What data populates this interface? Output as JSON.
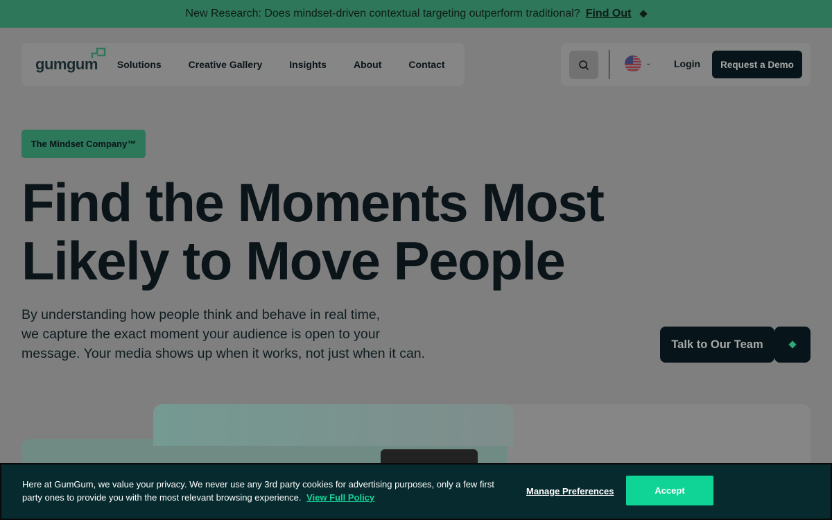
{
  "announcement": {
    "text": "New Research: Does mindset-driven contextual targeting outperform traditional?",
    "link": "Find Out"
  },
  "header": {
    "logo": "gumgum",
    "nav": [
      "Solutions",
      "Creative Gallery",
      "Insights",
      "About",
      "Contact"
    ],
    "login": "Login",
    "demo": "Request a Demo",
    "locale_icon": "us-flag-icon"
  },
  "hero": {
    "badge": "The Mindset Company™",
    "headline_line1": "Find the Moments Most",
    "headline_line2": "Likely to Move People",
    "sub_line1": "By understanding how people think and behave in real time,",
    "sub_line2": "we capture the exact moment your audience is open to your",
    "sub_line3": "message. Your media shows up when it works, not just when it can.",
    "cta": "Talk to Our Team"
  },
  "cookie": {
    "line1": "Here at GumGum, we value your privacy. We never use any 3rd party cookies for advertising purposes, only a few first",
    "line2": "party ones to provide you with the most relevant browsing experience.",
    "policy": "View Full Policy",
    "manage": "Manage Preferences",
    "accept": "Accept"
  },
  "colors": {
    "brand_green": "#2e775a",
    "accent_green": "#0fd495",
    "dark": "#071419",
    "cookie_bg": "#072a2e"
  }
}
